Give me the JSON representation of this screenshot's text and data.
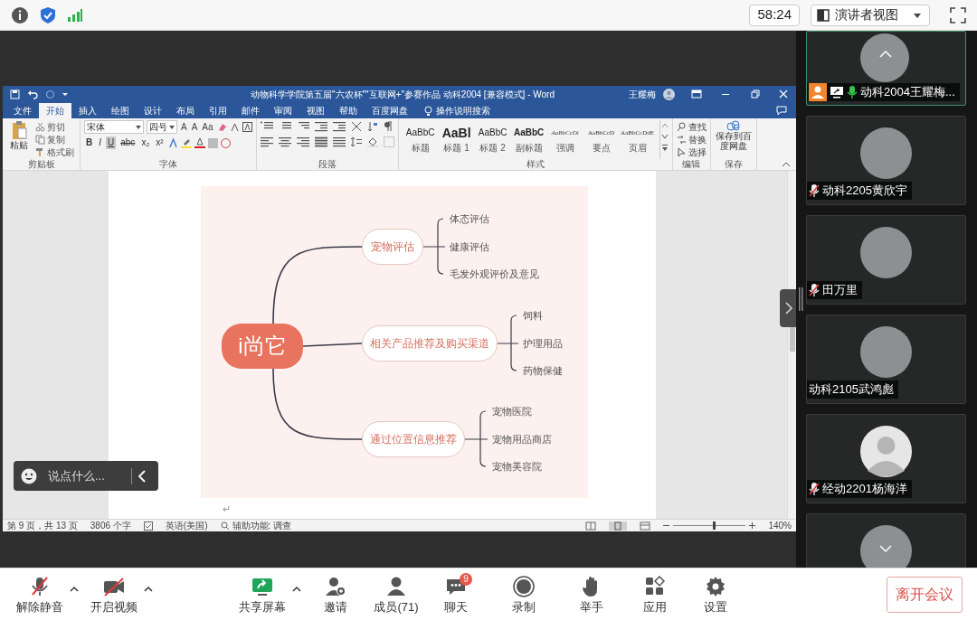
{
  "top_bar": {
    "timer": "58:24",
    "view_menu": "演讲者视图"
  },
  "word": {
    "title": "动物科学学院第五届\"六农杯\"\"互联网+\"参赛作品 动科2004 [兼容模式] - Word",
    "user": "王耀梅",
    "tabs": [
      {
        "label": "文件",
        "selected": false
      },
      {
        "label": "开始",
        "selected": true
      },
      {
        "label": "插入",
        "selected": false
      },
      {
        "label": "绘图",
        "selected": false
      },
      {
        "label": "设计",
        "selected": false
      },
      {
        "label": "布局",
        "selected": false
      },
      {
        "label": "引用",
        "selected": false
      },
      {
        "label": "邮件",
        "selected": false
      },
      {
        "label": "审阅",
        "selected": false
      },
      {
        "label": "视图",
        "selected": false
      },
      {
        "label": "帮助",
        "selected": false
      },
      {
        "label": "百度网盘",
        "selected": false
      }
    ],
    "tell_me": "操作说明搜索",
    "clipboard": {
      "paste": "粘贴",
      "items": [
        "剪切",
        "复制",
        "格式刷"
      ],
      "group": "剪贴板"
    },
    "font": {
      "name": "宋体",
      "size": "四号",
      "tools": [
        "A",
        "A",
        "Aa"
      ],
      "formats": [
        {
          "label": "B",
          "selected": false
        },
        {
          "label": "I",
          "selected": false
        },
        {
          "label": "U",
          "selected": true
        },
        {
          "label": "abc",
          "selected": false
        },
        {
          "label": "x₂",
          "selected": false
        },
        {
          "label": "x²",
          "selected": false
        }
      ],
      "group": "字体"
    },
    "paragraph": {
      "group": "段落"
    },
    "styles": {
      "items": [
        {
          "sample": "AaBbC",
          "name": "标题"
        },
        {
          "sample": "AaBl",
          "name": "标题 1"
        },
        {
          "sample": "AaBbC",
          "name": "标题 2"
        },
        {
          "sample": "AaBbC",
          "name": "副标题"
        },
        {
          "sample": "AaBbCcDi",
          "name": "强调"
        },
        {
          "sample": "AaBbCcD",
          "name": "要点"
        },
        {
          "sample": "AaBbCcDdE",
          "name": "页眉"
        }
      ],
      "group": "样式"
    },
    "editing": {
      "items": [
        "查找",
        "替换",
        "选择"
      ],
      "group": "编辑"
    },
    "save": {
      "button": "保存到百度网盘",
      "group": "保存"
    },
    "mind_map": {
      "root": "i尚它",
      "branches": [
        {
          "label": "宠物评估",
          "children": [
            "体态评估",
            "健康评估",
            "毛发外观评价及意见"
          ]
        },
        {
          "label": "相关产品推荐及购买渠道",
          "children": [
            "饲料",
            "护理用品",
            "药物保健"
          ]
        },
        {
          "label": "通过位置信息推荐",
          "children": [
            "宠物医院",
            "宠物用品商店",
            "宠物美容院"
          ]
        }
      ]
    },
    "paragraph_mark": "↵",
    "status_bar": {
      "page": "第 9 页，共 13 页",
      "words": "3806 个字",
      "language": "英语(美国)",
      "accessibility": "辅助功能: 调查",
      "zoom": "140%",
      "zoom_slider": {
        "level": 0.55
      }
    }
  },
  "chat_box": {
    "placeholder": "说点什么..."
  },
  "participants": [
    {
      "name": "动科2004王耀梅...",
      "mic_shown": true,
      "muted": false,
      "host": true,
      "sharing": true,
      "active": true,
      "default_avatar": false
    },
    {
      "name": "动科2205黄欣宇",
      "mic_shown": true,
      "muted": true,
      "host": false,
      "sharing": false,
      "active": false,
      "default_avatar": false
    },
    {
      "name": "田万里",
      "mic_shown": true,
      "muted": true,
      "host": false,
      "sharing": false,
      "active": false,
      "default_avatar": false
    },
    {
      "name": "动科2105武鸿彪",
      "mic_shown": false,
      "host": false,
      "sharing": false,
      "active": false,
      "default_avatar": false
    },
    {
      "name": "经动2201杨海洋",
      "mic_shown": true,
      "muted": true,
      "host": false,
      "sharing": false,
      "active": false,
      "default_avatar": true
    },
    {
      "mic_shown": false,
      "host": false,
      "sharing": false,
      "active": false,
      "default_avatar": false
    }
  ],
  "toolbar": [
    {
      "label": "解除静音",
      "kind": "mic_muted",
      "menu": true
    },
    {
      "label": "开启视频",
      "kind": "video_off",
      "menu": true
    },
    {
      "label": "共享屏幕",
      "kind": "share",
      "menu": true
    },
    {
      "label": "邀请",
      "kind": "invite",
      "menu": false
    },
    {
      "label": "成员(71)",
      "kind": "members",
      "menu": false
    },
    {
      "label": "聊天",
      "kind": "chat",
      "menu": false,
      "badge": "9"
    },
    {
      "label": "录制",
      "kind": "record",
      "menu": false
    },
    {
      "label": "举手",
      "kind": "hand",
      "menu": false
    },
    {
      "label": "应用",
      "kind": "apps",
      "menu": false
    },
    {
      "label": "设置",
      "kind": "settings",
      "menu": false
    }
  ],
  "leave_button": "离开会议"
}
